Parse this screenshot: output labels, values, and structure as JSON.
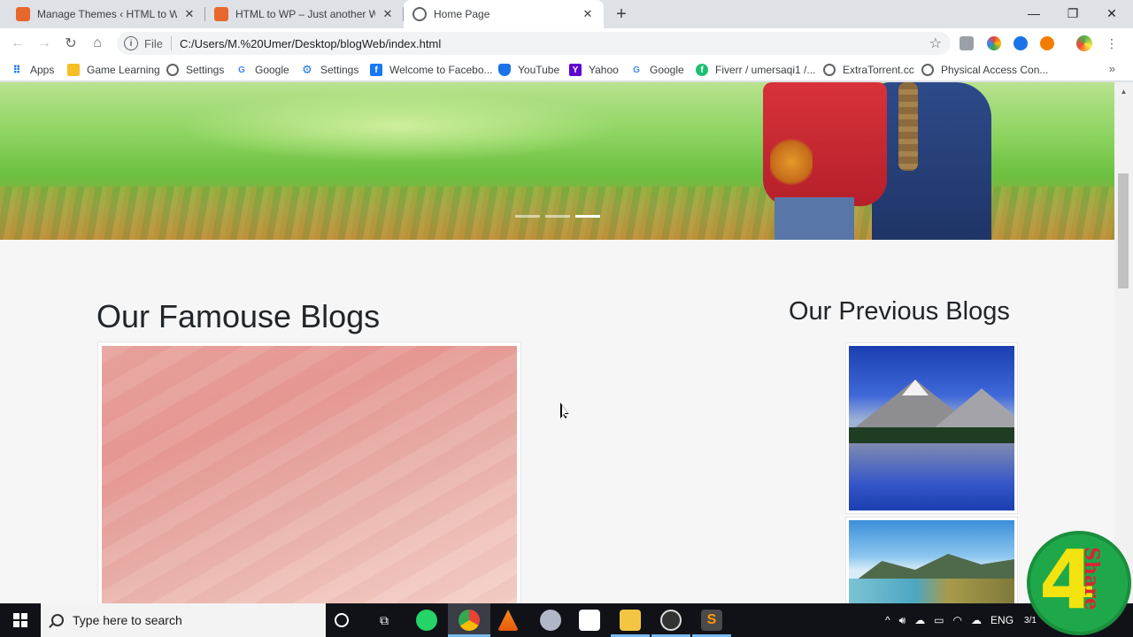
{
  "browser": {
    "tabs": [
      {
        "title": "Manage Themes ‹ HTML to WP – ",
        "favicon_color": "#e8672c",
        "active": false
      },
      {
        "title": "HTML to WP – Just another Wor",
        "favicon_color": "#e8672c",
        "active": false
      },
      {
        "title": "Home Page",
        "favicon_color": "#5f6368",
        "active": true
      }
    ],
    "new_tab": "+",
    "window_controls": {
      "minimize": "—",
      "restore": "❐",
      "close": "✕"
    },
    "address": {
      "scheme_label": "File",
      "url": "C:/Users/M.%20Umer/Desktop/blogWeb/index.html"
    },
    "bookmarks": [
      {
        "label": "Apps",
        "icon": "apps-grid-icon",
        "color": "#1a73e8"
      },
      {
        "label": "Game Learning",
        "icon": "folder-icon",
        "color": "#f6bf26"
      },
      {
        "label": "Settings",
        "icon": "chrome-settings-icon",
        "color": "#5f6368"
      },
      {
        "label": "Google",
        "icon": "google-icon",
        "color": "#4285f4"
      },
      {
        "label": "Settings",
        "icon": "gear-icon",
        "color": "#1a73e8"
      },
      {
        "label": "Welcome to Facebo...",
        "icon": "facebook-icon",
        "color": "#1877f2"
      },
      {
        "label": "YouTube",
        "icon": "shield-icon",
        "color": "#1a73e8"
      },
      {
        "label": "Yahoo",
        "icon": "yahoo-icon",
        "color": "#5f01d1"
      },
      {
        "label": "Google",
        "icon": "google-icon",
        "color": "#4285f4"
      },
      {
        "label": "Fiverr / umersaqi1 /...",
        "icon": "fiverr-icon",
        "color": "#1dbf73"
      },
      {
        "label": "ExtraTorrent.cc",
        "icon": "globe-icon",
        "color": "#5f6368"
      },
      {
        "label": "Physical Access Con...",
        "icon": "globe-icon",
        "color": "#5f6368"
      }
    ],
    "bookmarks_more": "»"
  },
  "page": {
    "carousel": {
      "slide_count": 3,
      "active_index": 2
    },
    "famous_heading": "Our Famouse Blogs",
    "previous_heading": "Our Previous Blogs"
  },
  "taskbar": {
    "search_placeholder": "Type here to search",
    "language": "ENG",
    "time_partial": "3/1"
  },
  "watermark": {
    "text": "4",
    "subtext": "Share"
  }
}
